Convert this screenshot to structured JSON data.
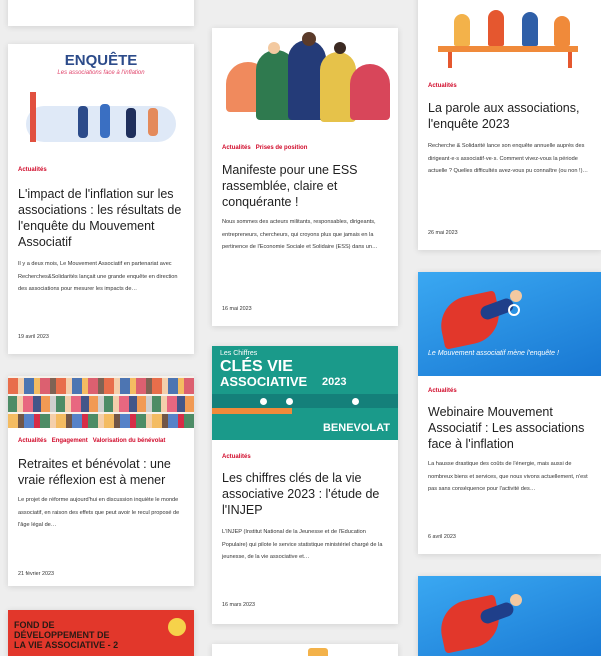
{
  "cards": {
    "c1": {
      "image_label": "ENQUÊTE",
      "image_sublabel": "Les associations face à l'inflation",
      "categories": [
        "Actualités"
      ],
      "title": "L'impact de l'inflation sur les associations : les résultats de l'enquête du Mouvement Associatif",
      "excerpt": "Il y a deux mois, Le Mouvement Associatif en partenariat avec Recherches&Solidarités lançait une grande enquête en direction des associations pour mesurer les impacts de…",
      "date": "19 avril 2023"
    },
    "c2": {
      "categories": [
        "Actualités",
        "Prises de position"
      ],
      "title": "Manifeste pour une ESS rassemblée, claire et conquérante !",
      "excerpt": "Nous sommes des acteurs militants, responsables, dirigeants, entrepreneurs, chercheurs, qui croyons plus que jamais en la pertinence de l'Economie Sociale et Solidaire (ESS) dans un…",
      "date": "16 mai 2023"
    },
    "c3": {
      "categories": [
        "Actualités"
      ],
      "title": "La parole aux associations, l'enquête 2023",
      "excerpt": "Recherche & Solidarité lance son enquête annuelle auprès des dirigeant·e·s associatif·ve·s. Comment vivez-vous la période actuelle ? Quelles difficultés avez-vous pu connaître (ou non !)…",
      "date": "26 mai 2023"
    },
    "c4": {
      "categories": [
        "Actualités",
        "Engagement",
        "Valorisation du bénévolat"
      ],
      "title": "Retraites et bénévolat : une vraie réflexion est à mener",
      "excerpt": "Le projet de réforme aujourd'hui en discussion inquiète le monde associatif, en raison des effets que peut avoir le recul proposé de l'âge légal de…",
      "date": "21 février 2023"
    },
    "c5": {
      "image_line1": "Les Chiffres",
      "image_line2": "CLÉS VIE",
      "image_line3": "ASSOCIATIVE",
      "image_year": "2023",
      "image_tag": "BENEVOLAT",
      "categories": [
        "Actualités"
      ],
      "title": "Les chiffres clés de la vie associative 2023 : l'étude de l'INJEP",
      "excerpt": "L'INJEP (Institut National de la Jeunesse et de l'Education Populaire) qui pilote le service statistique ministériel chargé de la jeunesse, de la vie associative et…",
      "date": "16 mars 2023"
    },
    "c6": {
      "image_caption": "Le Mouvement associatif mène l'enquête !",
      "categories": [
        "Actualités"
      ],
      "title": "Webinaire Mouvement Associatif : Les associations face à l'inflation",
      "excerpt": "La hausse drastique des coûts de l'énergie, mais aussi de nombreux biens et services, que nous vivons actuellement, n'est pas sans conséquence pour l'activité des…",
      "date": "6 avril 2023"
    },
    "c7": {
      "image_line1": "FOND DE",
      "image_line2": "DÉVELOPPEMENT DE",
      "image_line3": "LA VIE ASSOCIATIVE - 2"
    }
  },
  "colors": {
    "category_red": "#d10a2a",
    "teal": "#1a9a8a",
    "blue": "#1f8be0",
    "red_banner": "#e2372b"
  }
}
